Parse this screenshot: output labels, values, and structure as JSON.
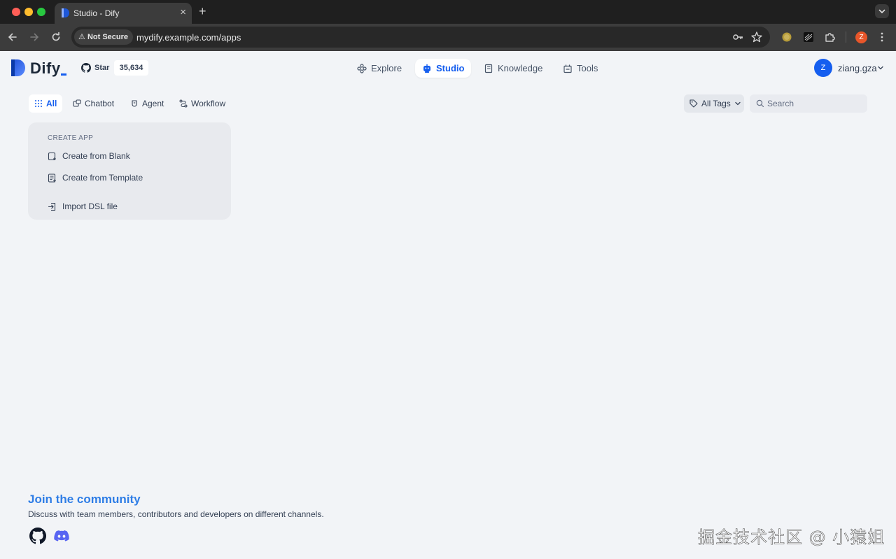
{
  "browser": {
    "tab_title": "Studio - Dify",
    "tab_close": "×",
    "new_tab": "+",
    "security_label": "Not Secure",
    "url": "mydify.example.com/apps",
    "profile_initial": "Z"
  },
  "header": {
    "logo_text": "Dify",
    "star_label": "Star",
    "star_count": "35,634",
    "nav": [
      {
        "label": "Explore",
        "icon": "explore-icon"
      },
      {
        "label": "Studio",
        "icon": "studio-icon",
        "active": true
      },
      {
        "label": "Knowledge",
        "icon": "knowledge-icon"
      },
      {
        "label": "Tools",
        "icon": "tools-icon"
      }
    ],
    "user": {
      "initial": "Z",
      "name": "ziang.gza"
    }
  },
  "filters": {
    "tabs": [
      {
        "label": "All",
        "icon": "grid-icon",
        "active": true
      },
      {
        "label": "Chatbot",
        "icon": "chatbot-icon"
      },
      {
        "label": "Agent",
        "icon": "agent-icon"
      },
      {
        "label": "Workflow",
        "icon": "workflow-icon"
      }
    ],
    "tags_label": "All Tags",
    "search_placeholder": "Search"
  },
  "create_app": {
    "heading": "CREATE APP",
    "items": [
      {
        "label": "Create from Blank",
        "icon": "create-blank-icon"
      },
      {
        "label": "Create from Template",
        "icon": "template-icon"
      },
      {
        "label": "Import DSL file",
        "icon": "import-icon"
      }
    ]
  },
  "community": {
    "title": "Join the community",
    "description": "Discuss with team members, contributors and developers on different channels."
  },
  "watermark": "掘金技术社区 @ 小猿姐",
  "colors": {
    "accent": "#155eef",
    "page_bg": "#f2f4f7",
    "community_title": "#2e7de6"
  }
}
